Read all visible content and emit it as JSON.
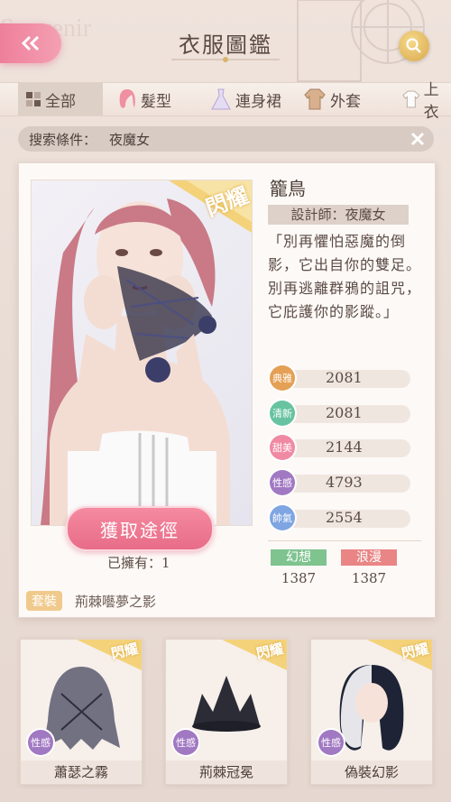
{
  "header": {
    "title": "衣服圖鑑",
    "back_icon": "double-chevron-left-icon",
    "search_icon": "magnifier-icon"
  },
  "categories": [
    {
      "label": "全部",
      "icon": "grid-icon",
      "active": true
    },
    {
      "label": "髮型",
      "icon": "hair-icon",
      "active": false
    },
    {
      "label": "連身裙",
      "icon": "dress-icon",
      "active": false
    },
    {
      "label": "外套",
      "icon": "coat-icon",
      "active": false
    },
    {
      "label": "上衣",
      "icon": "shirt-icon",
      "active": false
    }
  ],
  "filter": {
    "label": "搜索條件：",
    "value": "夜魔女"
  },
  "detail": {
    "badge": "閃耀",
    "name": "籠鳥",
    "designer": "設計師：夜魔女",
    "description": "「別再懼怕惡魔的倒影，它出自你的雙足。別再逃離群鴉的詛咒，它庇護你的影蹤。」",
    "get_button": "獲取途徑",
    "owned": "已擁有：1",
    "suit_tag": "套裝",
    "suit_name": "荊棘囈夢之影",
    "stats": [
      {
        "label": "典雅",
        "value": "2081",
        "color": "#e4a054"
      },
      {
        "label": "清新",
        "value": "2081",
        "color": "#67c3a0"
      },
      {
        "label": "甜美",
        "value": "2144",
        "color": "#f08aa3"
      },
      {
        "label": "性感",
        "value": "4793",
        "color": "#a178c2"
      },
      {
        "label": "帥氣",
        "value": "2554",
        "color": "#7fa5e2"
      }
    ],
    "attrs": [
      {
        "label": "幻想",
        "value": "1387",
        "color": "#7fc38f"
      },
      {
        "label": "浪漫",
        "value": "1387",
        "color": "#e98585"
      }
    ]
  },
  "items": [
    {
      "name": "蕭瑟之霧",
      "tag": "性感",
      "badge": "閃耀"
    },
    {
      "name": "荊棘冠冕",
      "tag": "性感",
      "badge": "閃耀"
    },
    {
      "name": "偽裝幻影",
      "tag": "性感",
      "badge": "閃耀"
    }
  ]
}
